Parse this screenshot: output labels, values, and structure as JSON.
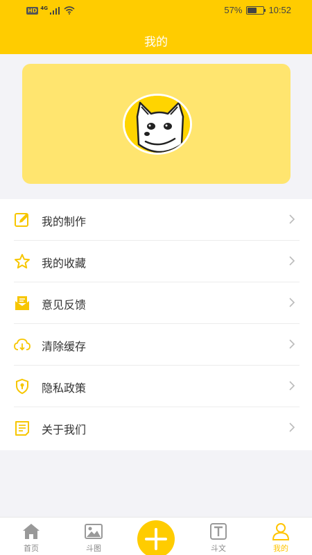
{
  "status_bar": {
    "network": "4G",
    "hd": "HD",
    "battery": "57%",
    "time": "10:52"
  },
  "header": {
    "title": "我的"
  },
  "menu": {
    "items": [
      {
        "label": "我的制作",
        "icon": "edit-icon"
      },
      {
        "label": "我的收藏",
        "icon": "star-icon"
      },
      {
        "label": "意见反馈",
        "icon": "mail-icon"
      },
      {
        "label": "清除缓存",
        "icon": "cloud-download-icon"
      },
      {
        "label": "隐私政策",
        "icon": "shield-icon"
      },
      {
        "label": "关于我们",
        "icon": "document-icon"
      }
    ]
  },
  "tabbar": {
    "items": [
      {
        "label": "首页",
        "icon": "home-icon"
      },
      {
        "label": "斗图",
        "icon": "image-icon"
      },
      {
        "label": "斗文",
        "icon": "text-icon"
      },
      {
        "label": "我的",
        "icon": "user-icon"
      }
    ]
  },
  "colors": {
    "accent": "#ffcc00",
    "card": "#ffe56f",
    "icon": "#f7c600",
    "tab_inactive": "#888888"
  }
}
